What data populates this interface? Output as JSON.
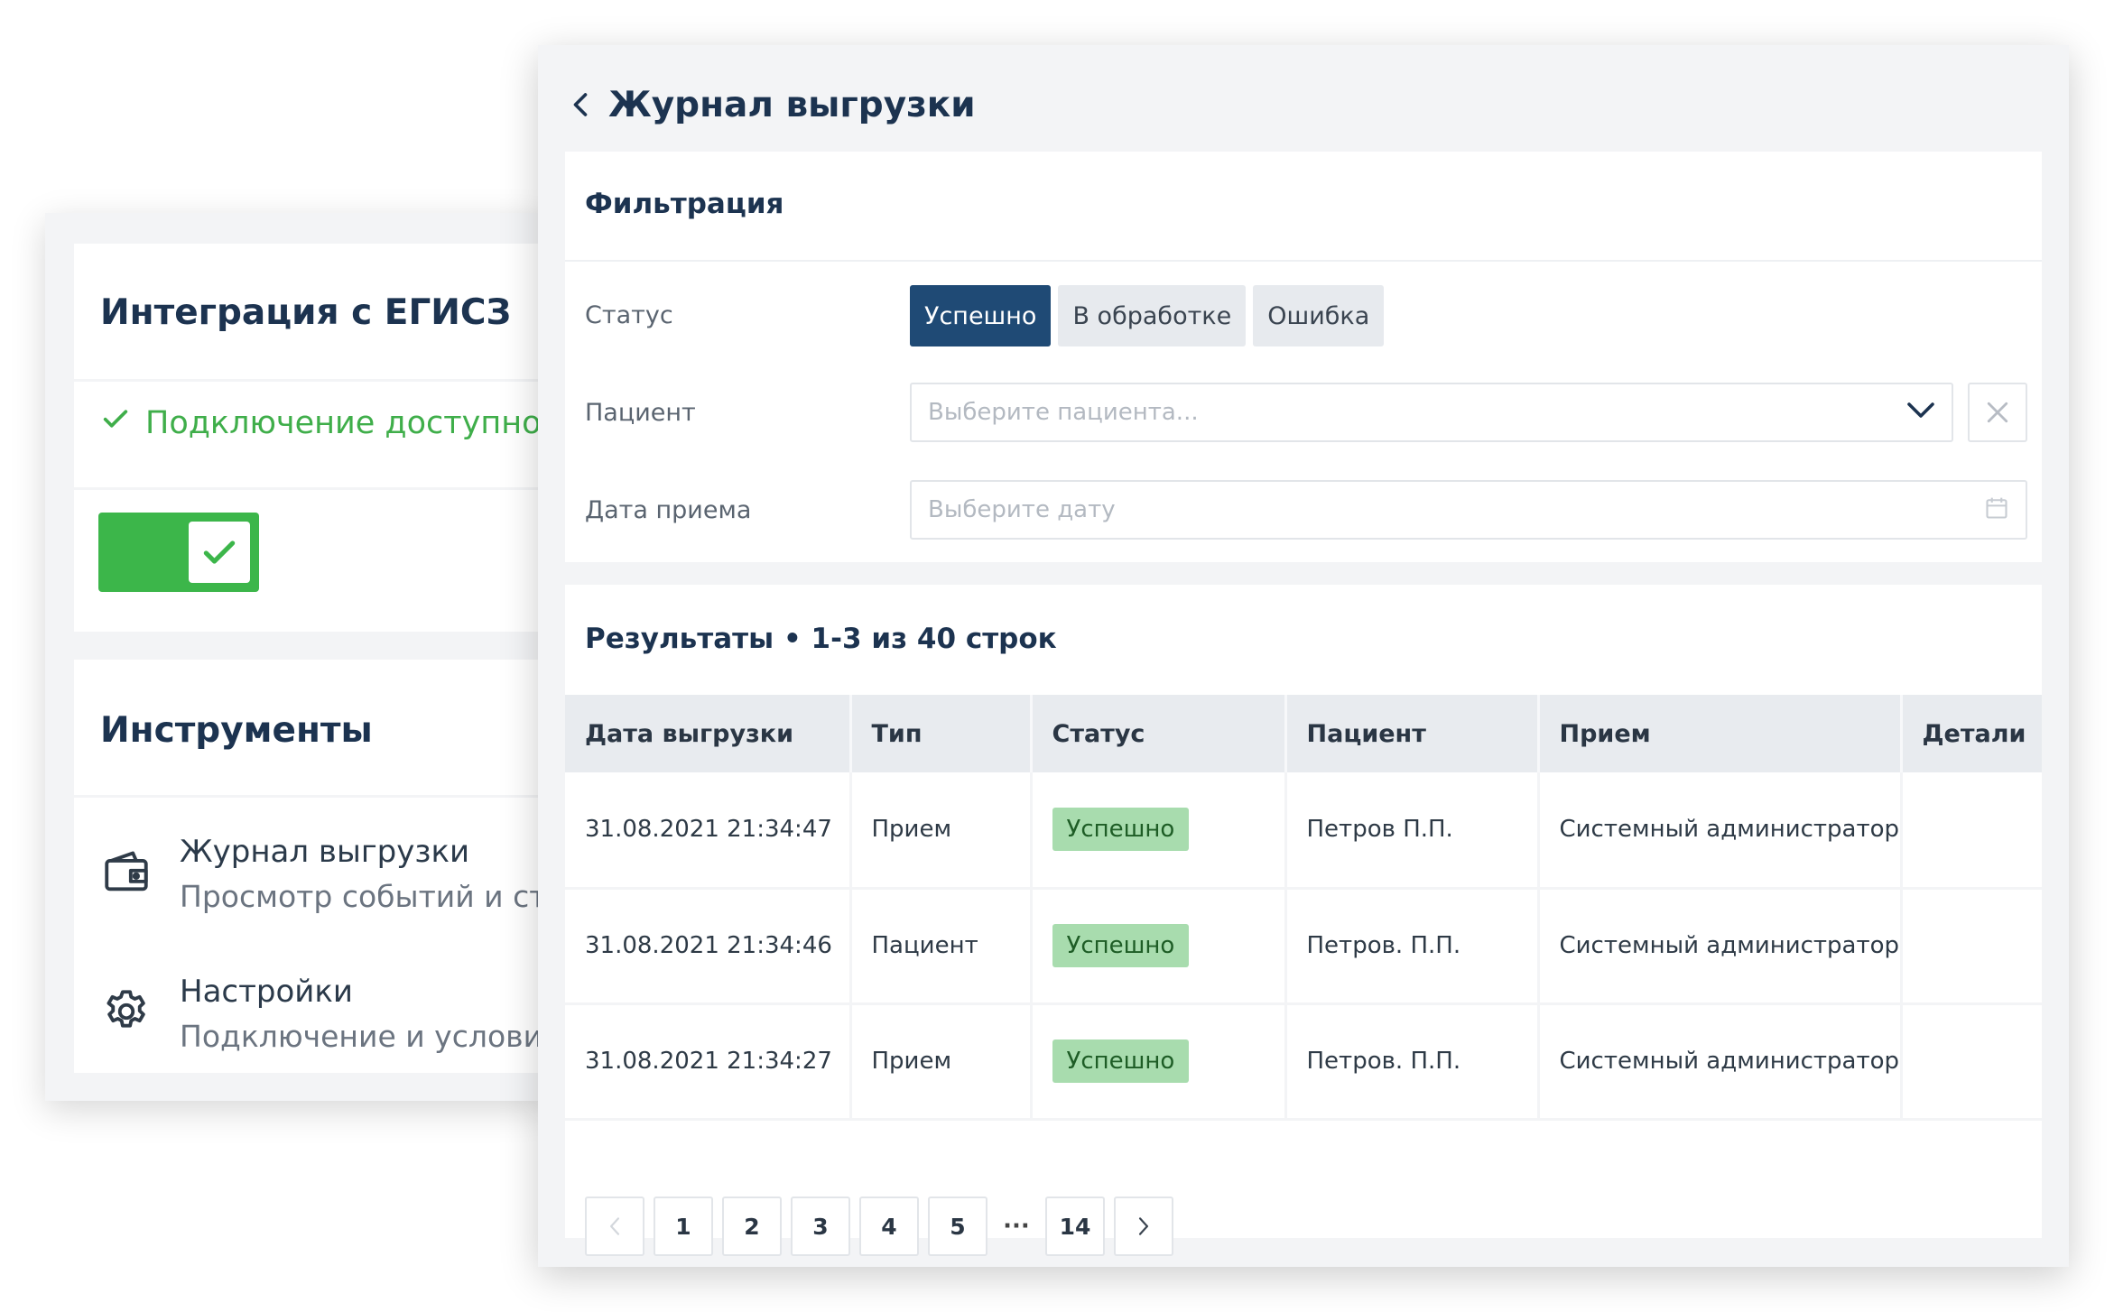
{
  "integration": {
    "title": "Интеграция с ЕГИСЗ",
    "status_text": "Подключение доступно",
    "toggle_on": true
  },
  "tools": {
    "title": "Инструменты",
    "items": [
      {
        "title": "Журнал выгрузки",
        "subtitle": "Просмотр событий и стат",
        "icon": "wallet-icon"
      },
      {
        "title": "Настройки",
        "subtitle": "Подключение и условия",
        "icon": "gear-icon"
      }
    ]
  },
  "journal": {
    "title": "Журнал выгрузки",
    "filter": {
      "heading": "Фильтрация",
      "status_label": "Статус",
      "status_options": [
        "Успешно",
        "В обработке",
        "Ошибка"
      ],
      "status_selected": "Успешно",
      "patient_label": "Пациент",
      "patient_placeholder": "Выберите пациента...",
      "date_label": "Дата приема",
      "date_placeholder": "Выберите дату"
    },
    "results": {
      "heading": "Результаты • 1-3 из 40 строк",
      "columns": [
        "Дата выгрузки",
        "Тип",
        "Статус",
        "Пациент",
        "Прием",
        "Детали"
      ],
      "rows": [
        {
          "date": "31.08.2021 21:34:47",
          "type": "Прием",
          "status": "Успешно",
          "patient": "Петров П.П.",
          "reception": "Системный администратор"
        },
        {
          "date": "31.08.2021 21:34:46",
          "type": "Пациент",
          "status": "Успешно",
          "patient": "Петров. П.П.",
          "reception": "Системный администратор"
        },
        {
          "date": "31.08.2021 21:34:27",
          "type": "Прием",
          "status": "Успешно",
          "patient": "Петров. П.П.",
          "reception": "Системный администратор"
        }
      ]
    },
    "pagination": {
      "pages": [
        "1",
        "2",
        "3",
        "4",
        "5"
      ],
      "ellipsis": "···",
      "last": "14",
      "current": "1"
    }
  },
  "colors": {
    "accent": "#1f4a75",
    "success": "#3cb64a",
    "badge_bg": "#a8dcae",
    "title": "#1c3350"
  }
}
